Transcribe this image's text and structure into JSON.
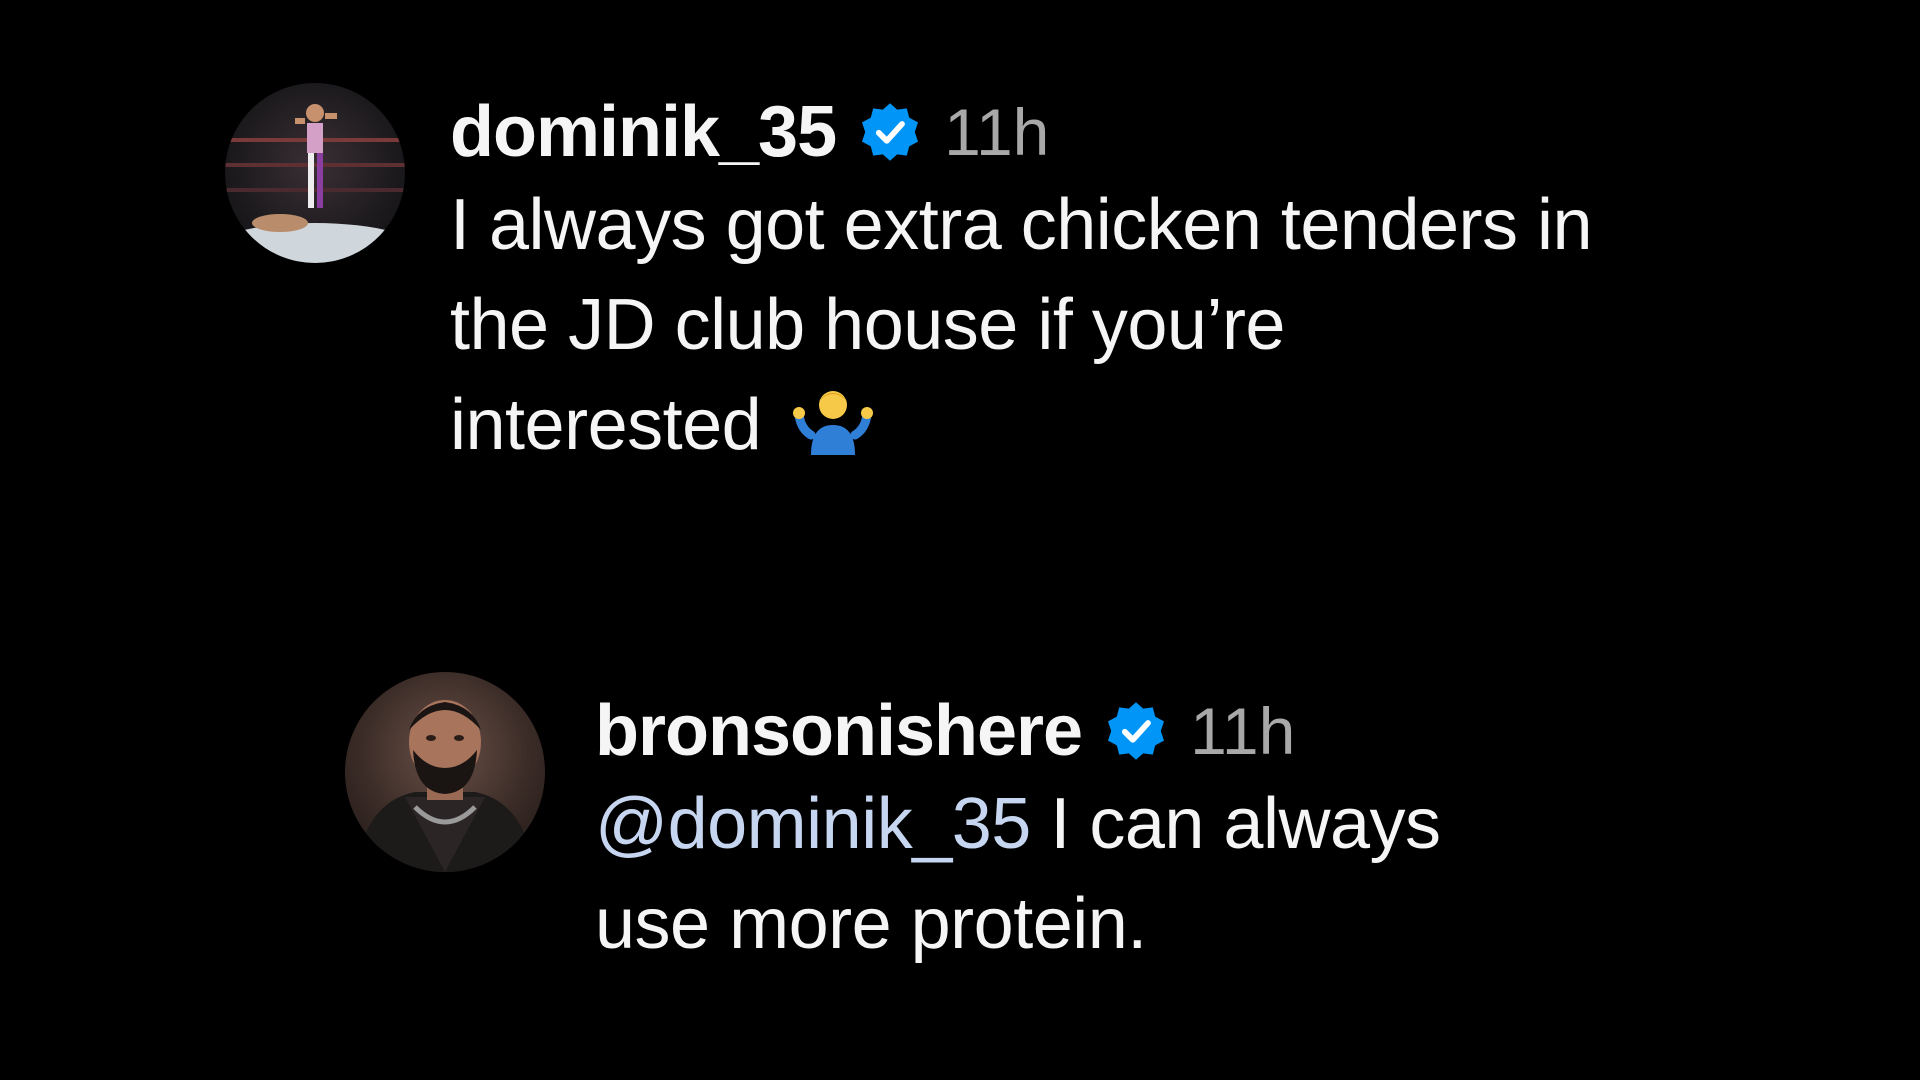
{
  "comments": [
    {
      "username": "dominik_35",
      "verified_icon": "verified-badge-icon",
      "time": "11h",
      "text_line1": "I always got extra chicken tenders in",
      "text_line2": "the JD club house if you’re",
      "text_line3": "interested",
      "emoji": "person-shrugging-emoji"
    },
    {
      "username": "bronsonishere",
      "verified_icon": "verified-badge-icon",
      "time": "11h",
      "mention": "@dominik_35",
      "text_rest": " I can always",
      "text_line2": "use more protein."
    }
  ],
  "colors": {
    "background": "#000000",
    "text": "#f5f5f5",
    "timestamp": "#a8a8a8",
    "verified": "#0095f6",
    "mention": "#c7d6f0"
  }
}
